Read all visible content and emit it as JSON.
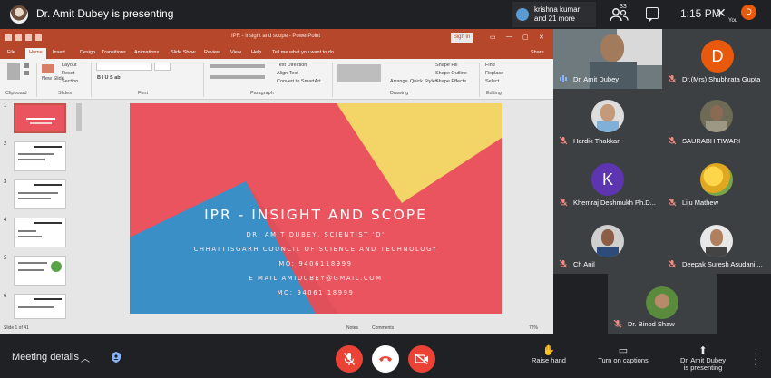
{
  "topbar": {
    "presenting": "Dr. Amit Dubey is presenting",
    "toast_line1": "krishna kumar",
    "toast_line2": "and 21 more",
    "participant_count": "33",
    "time": "1:15 PM",
    "you_initial": "D",
    "you_label": "You"
  },
  "ppt": {
    "doc_name": "IPR - insight and scope - PowerPoint",
    "sign_in": "Sign in",
    "tabs": [
      "File",
      "Home",
      "Insert",
      "Design",
      "Transitions",
      "Animations",
      "Slide Show",
      "Review",
      "View",
      "Help"
    ],
    "tell_me": "Tell me what you want to do",
    "share": "Share",
    "ribbon_groups": [
      "Clipboard",
      "Slides",
      "Font",
      "Paragraph",
      "Drawing",
      "Editing"
    ],
    "ribbon_items": {
      "layout": "Layout",
      "reset": "Reset",
      "section": "Section",
      "new_slide": "New Slide",
      "text_direction": "Text Direction",
      "align_text": "Align Text",
      "convert_smartart": "Convert to SmartArt",
      "arrange": "Arrange",
      "quick_styles": "Quick Styles",
      "shape_fill": "Shape Fill",
      "shape_outline": "Shape Outline",
      "shape_effects": "Shape Effects",
      "find": "Find",
      "replace": "Replace",
      "select": "Select"
    },
    "thumb_numbers": [
      "1",
      "2",
      "3",
      "4",
      "5",
      "6"
    ],
    "status_left": "Slide 1 of 41",
    "notes": "Notes",
    "comments": "Comments",
    "zoom": "72%"
  },
  "slide": {
    "title": "IPR - INSIGHT AND  SCOPE",
    "lines": [
      "DR. AMIT DUBEY, SCIENTIST 'D'",
      "CHHATTISGARH COUNCIL OF SCIENCE AND TECHNOLOGY",
      "MO: 9406118999",
      "E MAIL  AMIDUBEY@GMAIL.COM",
      "MO: 94061 18999"
    ]
  },
  "participants": [
    {
      "name": "Dr. Amit Dubey",
      "muted": false
    },
    {
      "name": "Dr.(Mrs) Shubhrata Gupta",
      "muted": true,
      "initial": "D",
      "color": "#e8590c"
    },
    {
      "name": "Hardik Thakkar",
      "muted": true
    },
    {
      "name": "SAURABH TIWARI",
      "muted": true
    },
    {
      "name": "Khemraj Deshmukh Ph.D...",
      "muted": true,
      "initial": "K",
      "color": "#5e35b1"
    },
    {
      "name": "Liju Mathew",
      "muted": true
    },
    {
      "name": "Ch Anil",
      "muted": true
    },
    {
      "name": "Deepak Suresh Asudani ...",
      "muted": true
    },
    {
      "name": "Dr. Binod Shaw",
      "muted": true
    }
  ],
  "bottombar": {
    "meeting_details": "Meeting details",
    "raise_hand": "Raise hand",
    "captions": "Turn on captions",
    "presenter_line1": "Dr. Amit Dubey",
    "presenter_line2": "is presenting"
  },
  "colors": {
    "bg": "#202124",
    "tile": "#3c4043",
    "red": "#ea4335",
    "ppt_accent": "#b7472a",
    "slide_red": "#e9545e",
    "slide_yellow": "#f3d466",
    "slide_blue": "#3a8fc7"
  }
}
